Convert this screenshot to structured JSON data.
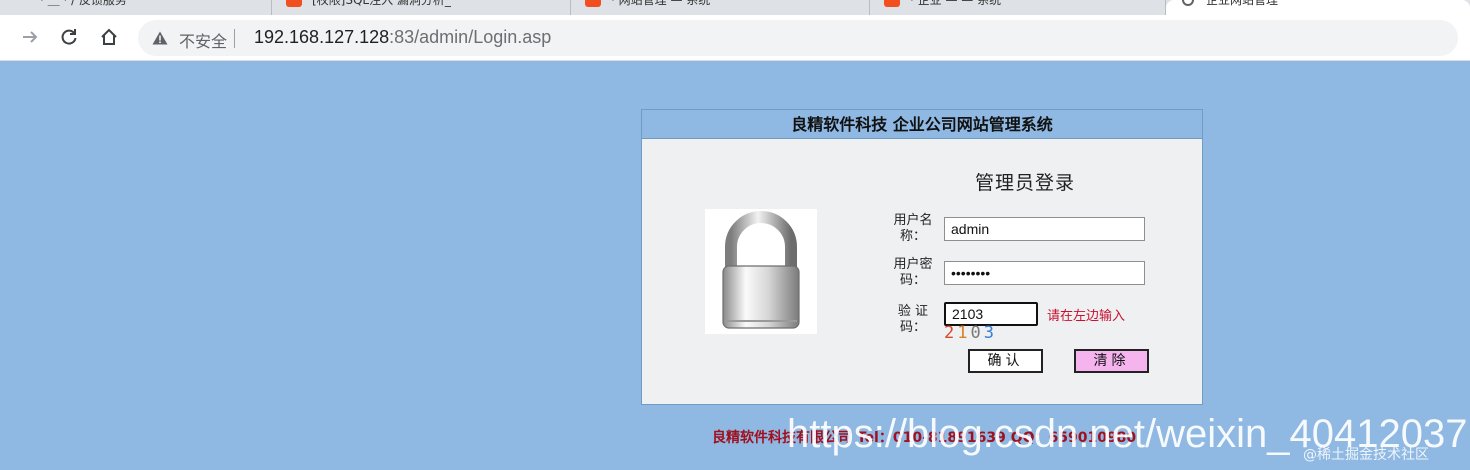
{
  "browser": {
    "tabs": [
      {
        "title": "· ＿ · / 反馈服务"
      },
      {
        "title": "[权限]SQL注入 漏洞分析_"
      },
      {
        "title": "· 网站管理 — 系统"
      },
      {
        "title": "· 企业 — — 系统"
      },
      {
        "title": "企业网站管理"
      }
    ],
    "address": {
      "security_label": "不安全",
      "url_host": "192.168.127.128",
      "url_rest": ":83/admin/Login.asp"
    }
  },
  "panel": {
    "header": "良精软件科技  企业公司网站管理系统",
    "title": "管理员登录",
    "username_label": [
      "用户名",
      "称："
    ],
    "username_value": "admin",
    "password_label": [
      "用户密",
      "码："
    ],
    "password_value": "password",
    "captcha_label": [
      "验  证",
      "码："
    ],
    "captcha_value": "2103",
    "captcha_hint": "请在左边输入",
    "captcha_digits": [
      {
        "d": "2",
        "color": "#d94a2a"
      },
      {
        "d": "1",
        "color": "#d9802a"
      },
      {
        "d": "0",
        "color": "#7a7a7a"
      },
      {
        "d": "3",
        "color": "#3b7fd6"
      }
    ],
    "confirm_label": "确认",
    "clear_label": "清除"
  },
  "footer": {
    "company": "良精软件科技有限公司  Tel：010-81891639  QQ：659010980"
  },
  "watermark": {
    "url": "https://blog.csdn.net/weixin_40412037",
    "community": "@稀土掘金技术社区"
  }
}
